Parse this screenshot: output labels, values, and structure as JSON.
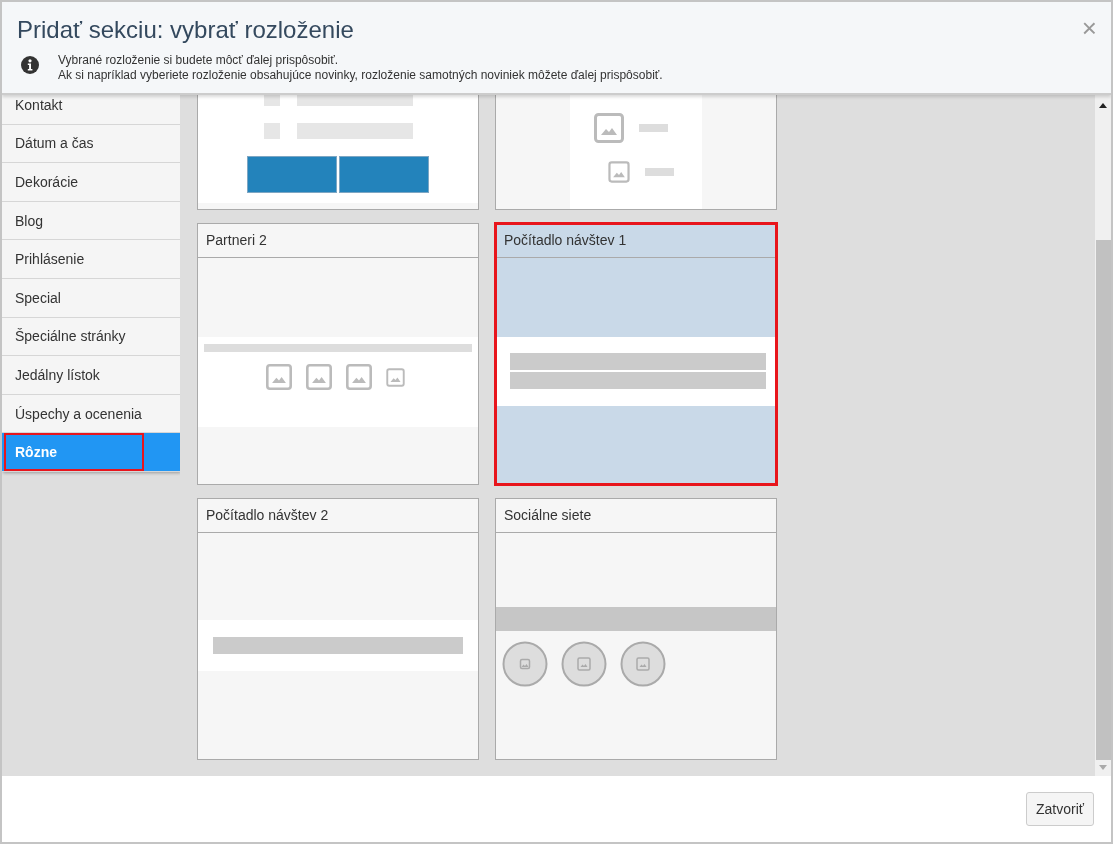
{
  "dialog": {
    "title": "Pridať sekciu: vybrať rozloženie",
    "info_lines": [
      "Vybrané rozloženie si budete môcť ďalej prispôsobiť.",
      "Ak si napríklad vyberiete rozloženie obsahujúce novinky, rozloženie samotných noviniek môžete ďalej prispôsobiť."
    ],
    "close": "×"
  },
  "sidebar": {
    "items": [
      {
        "label": "Kontakt",
        "selected": false,
        "highlighted": false
      },
      {
        "label": "Dátum a čas",
        "selected": false,
        "highlighted": false
      },
      {
        "label": "Dekorácie",
        "selected": false,
        "highlighted": false
      },
      {
        "label": "Blog",
        "selected": false,
        "highlighted": false
      },
      {
        "label": "Prihlásenie",
        "selected": false,
        "highlighted": false
      },
      {
        "label": "Special",
        "selected": false,
        "highlighted": false
      },
      {
        "label": "Špeciálne stránky",
        "selected": false,
        "highlighted": false
      },
      {
        "label": "Jedálny lístok",
        "selected": false,
        "highlighted": false
      },
      {
        "label": "Úspechy a ocenenia",
        "selected": false,
        "highlighted": false
      },
      {
        "label": "Rôzne",
        "selected": true,
        "highlighted": true
      }
    ]
  },
  "layouts": [
    {
      "kind": "buttons",
      "selected": false,
      "highlighted": false
    },
    {
      "kind": "image-list",
      "selected": false,
      "highlighted": false
    },
    {
      "title": "Partneri 2",
      "kind": "logos",
      "selected": false,
      "highlighted": false
    },
    {
      "title": "Počítadlo návštev 1",
      "kind": "counter",
      "selected": true,
      "highlighted": true
    },
    {
      "title": "Počítadlo návštev 2",
      "kind": "counter-single",
      "selected": false,
      "highlighted": false
    },
    {
      "title": "Sociálne siete",
      "kind": "social",
      "selected": false,
      "highlighted": false
    }
  ],
  "footer": {
    "close_button": "Zatvoriť"
  }
}
